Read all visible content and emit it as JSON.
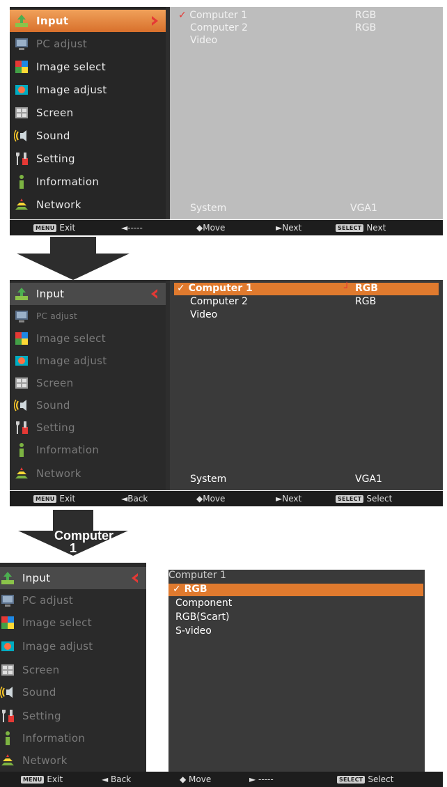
{
  "sidebar_items": [
    {
      "label": "Input",
      "icon": "input-icon"
    },
    {
      "label": "PC adjust",
      "icon": "pc-adjust-icon"
    },
    {
      "label": "Image select",
      "icon": "image-select-icon"
    },
    {
      "label": "Image adjust",
      "icon": "image-adjust-icon"
    },
    {
      "label": "Screen",
      "icon": "screen-icon"
    },
    {
      "label": "Sound",
      "icon": "sound-icon"
    },
    {
      "label": "Setting",
      "icon": "setting-icon"
    },
    {
      "label": "Information",
      "icon": "information-icon"
    },
    {
      "label": "Network",
      "icon": "network-icon"
    }
  ],
  "screen1": {
    "rows": [
      {
        "name": "Computer 1",
        "value": "RGB",
        "checked": true
      },
      {
        "name": "Computer 2",
        "value": "RGB"
      },
      {
        "name": "Video",
        "value": ""
      }
    ],
    "system_label": "System",
    "system_value": "VGA1",
    "footer": {
      "menu_key": "MENU",
      "exit": "Exit",
      "back": "◄-----",
      "move": "◆Move",
      "next": "►Next",
      "select_key": "SELECT",
      "select": "Next"
    }
  },
  "screen2": {
    "rows": [
      {
        "name": "Computer 1",
        "value": "RGB",
        "checked": true,
        "highlighted": true
      },
      {
        "name": "Computer 2",
        "value": "RGB"
      },
      {
        "name": "Video",
        "value": ""
      }
    ],
    "system_label": "System",
    "system_value": "VGA1",
    "footer": {
      "menu_key": "MENU",
      "exit": "Exit",
      "back": "◄Back",
      "move": "◆Move",
      "next": "►Next",
      "select_key": "SELECT",
      "select": "Select"
    }
  },
  "arrow2_label": "Computer 1",
  "screen3": {
    "header": "Computer 1",
    "rows": [
      {
        "name": "RGB",
        "checked": true,
        "highlighted": true
      },
      {
        "name": "Component"
      },
      {
        "name": "RGB(Scart)"
      },
      {
        "name": "S-video"
      }
    ],
    "footer": {
      "menu_key": "MENU",
      "exit": "Exit",
      "back": "◄ Back",
      "move": "◆ Move",
      "next": "► -----",
      "select_key": "SELECT",
      "select": "Select"
    }
  },
  "colors": {
    "accent": "#e07a2e",
    "menu_dark": "#262626",
    "panel_light": "#bdbdbd"
  }
}
